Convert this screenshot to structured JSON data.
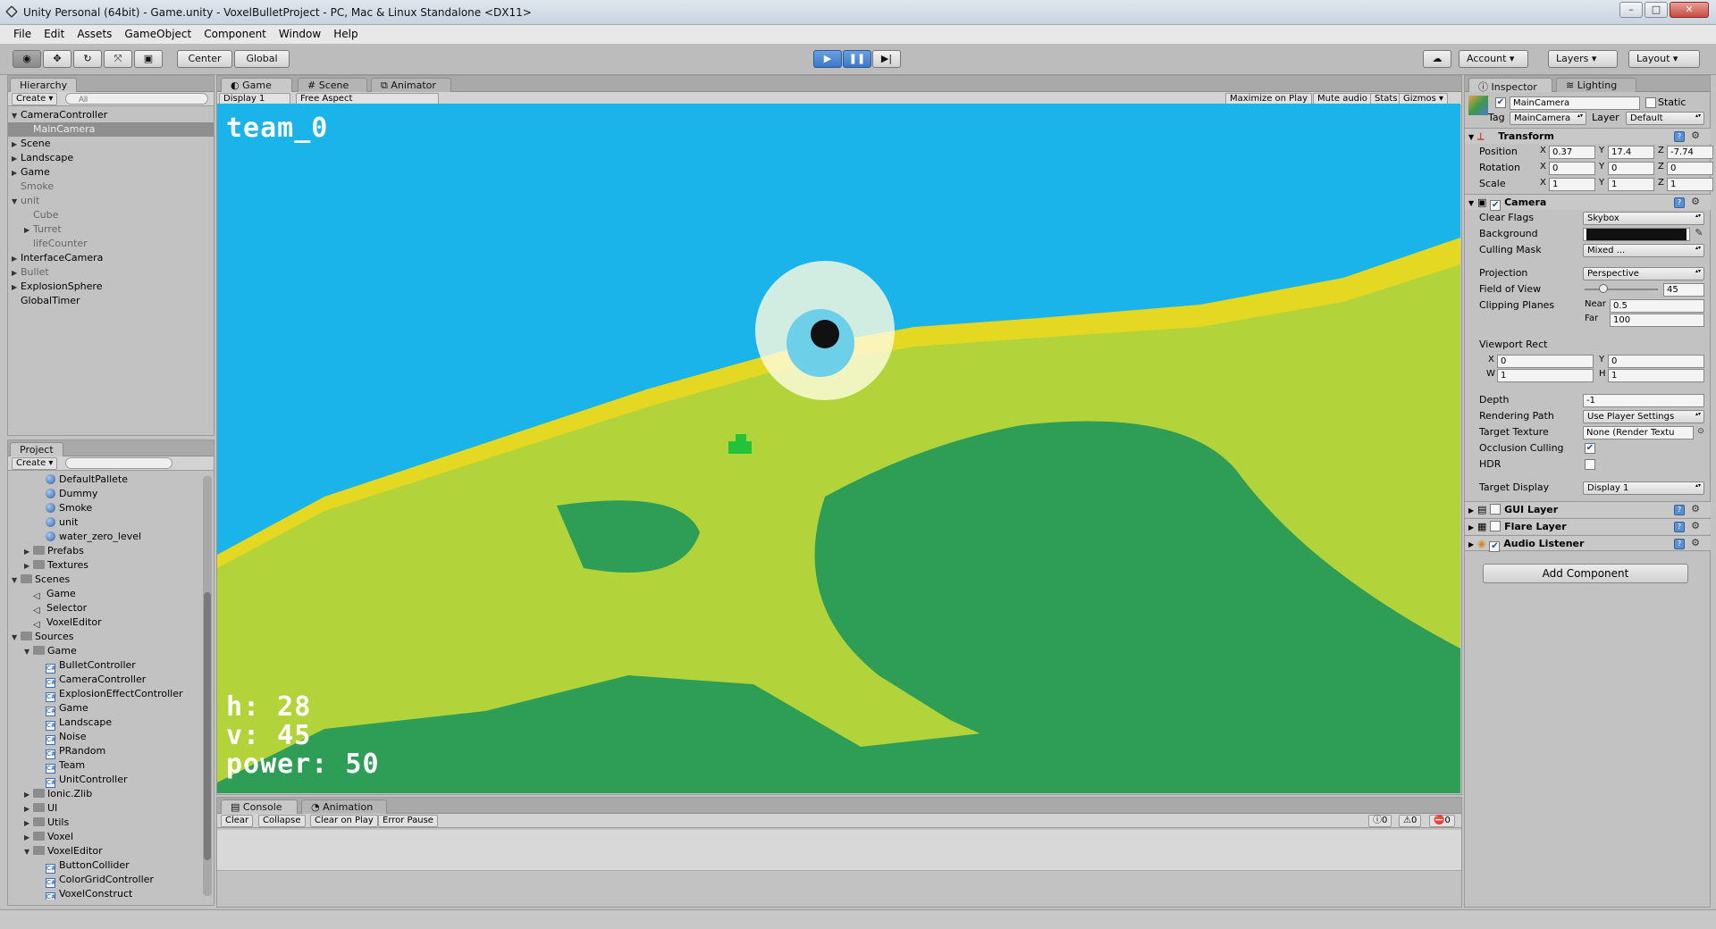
{
  "window": {
    "title": "Unity Personal (64bit) - Game.unity - VoxelBulletProject - PC, Mac & Linux Standalone <DX11>",
    "minimize": "–",
    "maximize": "□",
    "close": "✕"
  },
  "menu": [
    "File",
    "Edit",
    "Assets",
    "GameObject",
    "Component",
    "Window",
    "Help"
  ],
  "toolbar": {
    "pivot": "Center",
    "space": "Global",
    "account": "Account",
    "layers": "Layers",
    "layout": "Layout"
  },
  "hierarchy": {
    "tab": "Hierarchy",
    "create": "Create",
    "search_placeholder": "All",
    "items": [
      {
        "label": "CameraController",
        "depth": 0,
        "arrow": "open",
        "dim": false,
        "selected": false
      },
      {
        "label": "MainCamera",
        "depth": 1,
        "arrow": "",
        "dim": false,
        "selected": true
      },
      {
        "label": "Scene",
        "depth": 0,
        "arrow": "closed",
        "dim": false,
        "selected": false
      },
      {
        "label": "Landscape",
        "depth": 0,
        "arrow": "closed",
        "dim": false,
        "selected": false
      },
      {
        "label": "Game",
        "depth": 0,
        "arrow": "closed",
        "dim": false,
        "selected": false
      },
      {
        "label": "Smoke",
        "depth": 0,
        "arrow": "",
        "dim": true,
        "selected": false
      },
      {
        "label": "unit",
        "depth": 0,
        "arrow": "open",
        "dim": true,
        "selected": false
      },
      {
        "label": "Cube",
        "depth": 1,
        "arrow": "",
        "dim": true,
        "selected": false
      },
      {
        "label": "Turret",
        "depth": 1,
        "arrow": "closed",
        "dim": true,
        "selected": false
      },
      {
        "label": "lifeCounter",
        "depth": 1,
        "arrow": "",
        "dim": true,
        "selected": false
      },
      {
        "label": "InterfaceCamera",
        "depth": 0,
        "arrow": "closed",
        "dim": false,
        "selected": false
      },
      {
        "label": "Bullet",
        "depth": 0,
        "arrow": "closed",
        "dim": true,
        "selected": false
      },
      {
        "label": "ExplosionSphere",
        "depth": 0,
        "arrow": "closed",
        "dim": false,
        "selected": false
      },
      {
        "label": "GlobalTimer",
        "depth": 0,
        "arrow": "",
        "dim": false,
        "selected": false
      }
    ]
  },
  "project": {
    "tab": "Project",
    "create": "Create",
    "items": [
      {
        "label": "DefaultPallete",
        "depth": 2,
        "icon": "sphere",
        "arrow": ""
      },
      {
        "label": "Dummy",
        "depth": 2,
        "icon": "sphere",
        "arrow": ""
      },
      {
        "label": "Smoke",
        "depth": 2,
        "icon": "sphere",
        "arrow": ""
      },
      {
        "label": "unit",
        "depth": 2,
        "icon": "sphere",
        "arrow": ""
      },
      {
        "label": "water_zero_level",
        "depth": 2,
        "icon": "sphere",
        "arrow": ""
      },
      {
        "label": "Prefabs",
        "depth": 1,
        "icon": "folder",
        "arrow": "closed"
      },
      {
        "label": "Textures",
        "depth": 1,
        "icon": "folder",
        "arrow": "closed"
      },
      {
        "label": "Scenes",
        "depth": 0,
        "icon": "folder",
        "arrow": "open"
      },
      {
        "label": "Game",
        "depth": 1,
        "icon": "unity",
        "arrow": ""
      },
      {
        "label": "Selector",
        "depth": 1,
        "icon": "unity",
        "arrow": ""
      },
      {
        "label": "VoxelEditor",
        "depth": 1,
        "icon": "unity",
        "arrow": ""
      },
      {
        "label": "Sources",
        "depth": 0,
        "icon": "folder",
        "arrow": "open"
      },
      {
        "label": "Game",
        "depth": 1,
        "icon": "folder",
        "arrow": "open"
      },
      {
        "label": "BulletController",
        "depth": 2,
        "icon": "cs",
        "arrow": ""
      },
      {
        "label": "CameraController",
        "depth": 2,
        "icon": "cs",
        "arrow": ""
      },
      {
        "label": "ExplosionEffectController",
        "depth": 2,
        "icon": "cs",
        "arrow": ""
      },
      {
        "label": "Game",
        "depth": 2,
        "icon": "cs",
        "arrow": ""
      },
      {
        "label": "Landscape",
        "depth": 2,
        "icon": "cs",
        "arrow": ""
      },
      {
        "label": "Noise",
        "depth": 2,
        "icon": "cs",
        "arrow": ""
      },
      {
        "label": "PRandom",
        "depth": 2,
        "icon": "cs",
        "arrow": ""
      },
      {
        "label": "Team",
        "depth": 2,
        "icon": "cs",
        "arrow": ""
      },
      {
        "label": "UnitController",
        "depth": 2,
        "icon": "cs",
        "arrow": ""
      },
      {
        "label": "Ionic.Zlib",
        "depth": 1,
        "icon": "folder",
        "arrow": "closed"
      },
      {
        "label": "UI",
        "depth": 1,
        "icon": "folder",
        "arrow": "closed"
      },
      {
        "label": "Utils",
        "depth": 1,
        "icon": "folder",
        "arrow": "closed"
      },
      {
        "label": "Voxel",
        "depth": 1,
        "icon": "folder",
        "arrow": "closed"
      },
      {
        "label": "VoxelEditor",
        "depth": 1,
        "icon": "folder",
        "arrow": "open"
      },
      {
        "label": "ButtonCollider",
        "depth": 2,
        "icon": "cs",
        "arrow": ""
      },
      {
        "label": "ColorGridController",
        "depth": 2,
        "icon": "cs",
        "arrow": ""
      },
      {
        "label": "VoxelConstruct",
        "depth": 2,
        "icon": "cs",
        "arrow": ""
      }
    ]
  },
  "center_tabs": {
    "game": "Game",
    "scene": "Scene",
    "animator": "Animator"
  },
  "game_bar": {
    "display": "Display 1",
    "aspect": "Free Aspect",
    "maximize": "Maximize on Play",
    "mute": "Mute audio",
    "stats": "Stats",
    "gizmos": "Gizmos"
  },
  "hud": {
    "team": "team_0",
    "h": "h: 28",
    "v": "v: 45",
    "power": "power: 50"
  },
  "console": {
    "tab": "Console",
    "tab2": "Animation",
    "clear": "Clear",
    "collapse": "Collapse",
    "clear_on_play": "Clear on Play",
    "error_pause": "Error Pause",
    "info_count": "0",
    "warn_count": "0",
    "error_count": "0"
  },
  "inspector": {
    "tab": "Inspector",
    "tab2": "Lighting",
    "object_name": "MainCamera",
    "static_label": "Static",
    "tag_label": "Tag",
    "tag": "MainCamera",
    "layer_label": "Layer",
    "layer": "Default",
    "transform": {
      "title": "Transform",
      "position_label": "Position",
      "rotation_label": "Rotation",
      "scale_label": "Scale",
      "position": [
        "0.37",
        "17.4",
        "-7.74"
      ],
      "rotation": [
        "0",
        "0",
        "0"
      ],
      "scale": [
        "1",
        "1",
        "1"
      ]
    },
    "camera": {
      "title": "Camera",
      "clear_flags_label": "Clear Flags",
      "clear_flags": "Skybox",
      "background_label": "Background",
      "background_color": "#111111",
      "culling_mask_label": "Culling Mask",
      "culling_mask": "Mixed ...",
      "projection_label": "Projection",
      "projection": "Perspective",
      "fov_label": "Field of View",
      "fov": "45",
      "clipping_label": "Clipping Planes",
      "near_label": "Near",
      "near": "0.5",
      "far_label": "Far",
      "far": "100",
      "viewport_label": "Viewport Rect",
      "vx": "0",
      "vy": "0",
      "vw": "1",
      "vh": "1",
      "depth_label": "Depth",
      "depth": "-1",
      "rendering_path_label": "Rendering Path",
      "rendering_path": "Use Player Settings",
      "target_texture_label": "Target Texture",
      "target_texture": "None (Render Textu",
      "occlusion_label": "Occlusion Culling",
      "hdr_label": "HDR",
      "target_display_label": "Target Display",
      "target_display": "Display 1"
    },
    "components": [
      "GUI Layer",
      "Flare Layer",
      "Audio Listener"
    ],
    "add_component": "Add Component"
  },
  "colors": {
    "sky": "#1ab3ea",
    "sand": "#e4d822",
    "grass": "#b2d43a",
    "dark_grass": "#2e9e57",
    "tank": "#22c23a"
  }
}
